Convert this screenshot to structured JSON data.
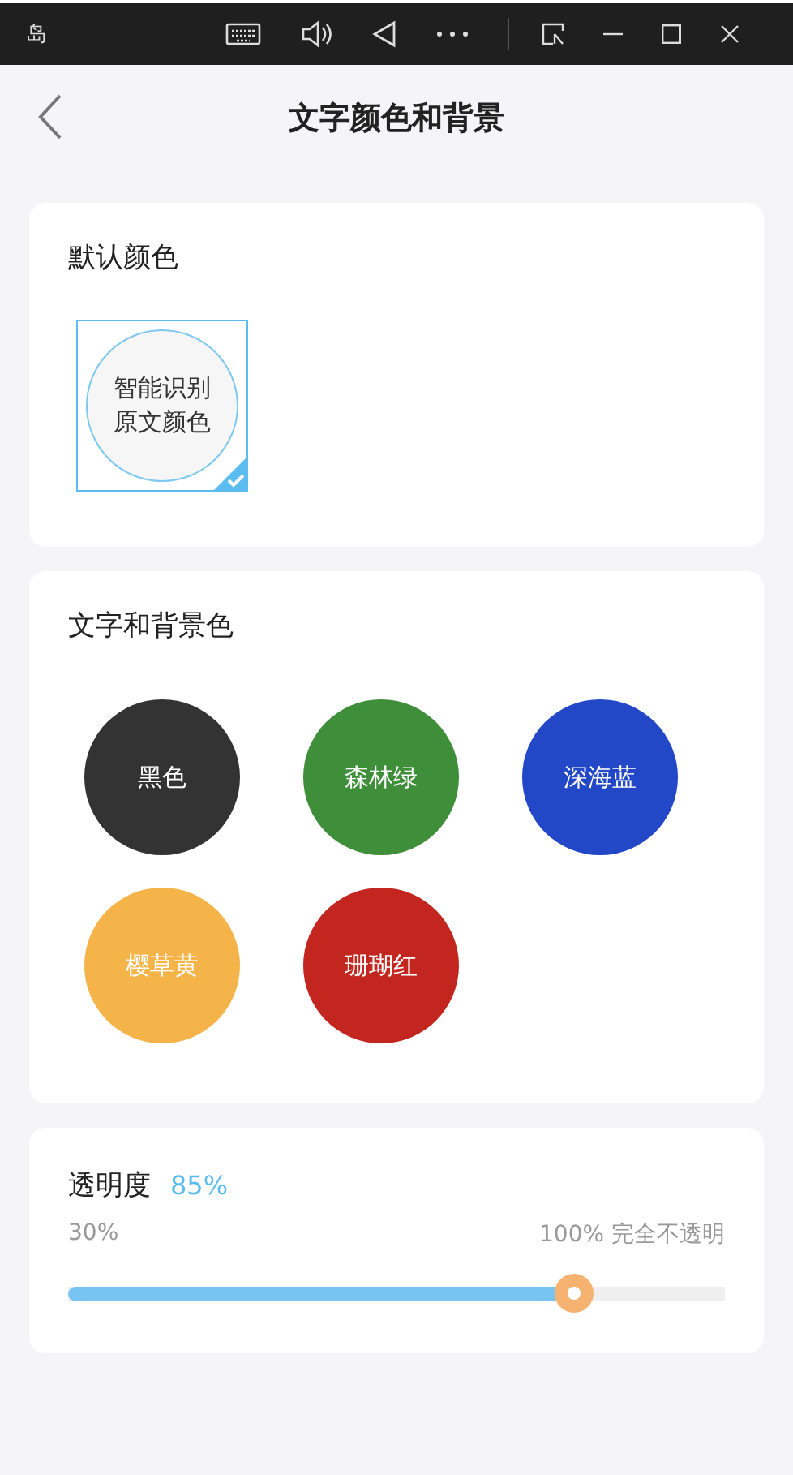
{
  "system_bar": {
    "app_label": "岛"
  },
  "header": {
    "title": "文字颜色和背景"
  },
  "default_section": {
    "title": "默认颜色",
    "option": {
      "label": "智能识别原文颜色",
      "selected": true
    }
  },
  "color_section": {
    "title": "文字和背景色",
    "colors": [
      {
        "label": "黑色",
        "color": "#333333",
        "selected": false
      },
      {
        "label": "森林绿",
        "color": "#3f8f3a",
        "selected": false
      },
      {
        "label": "深海蓝",
        "color": "#2248c8",
        "selected": false
      },
      {
        "label": "樱草黄",
        "color": "#f5b44a",
        "selected": false
      },
      {
        "label": "珊瑚红",
        "color": "#c2261f",
        "selected": false
      }
    ]
  },
  "opacity": {
    "title": "透明度",
    "value": "85%",
    "min_label": "30%",
    "max_label": "100% 完全不透明",
    "level": 0.77
  }
}
